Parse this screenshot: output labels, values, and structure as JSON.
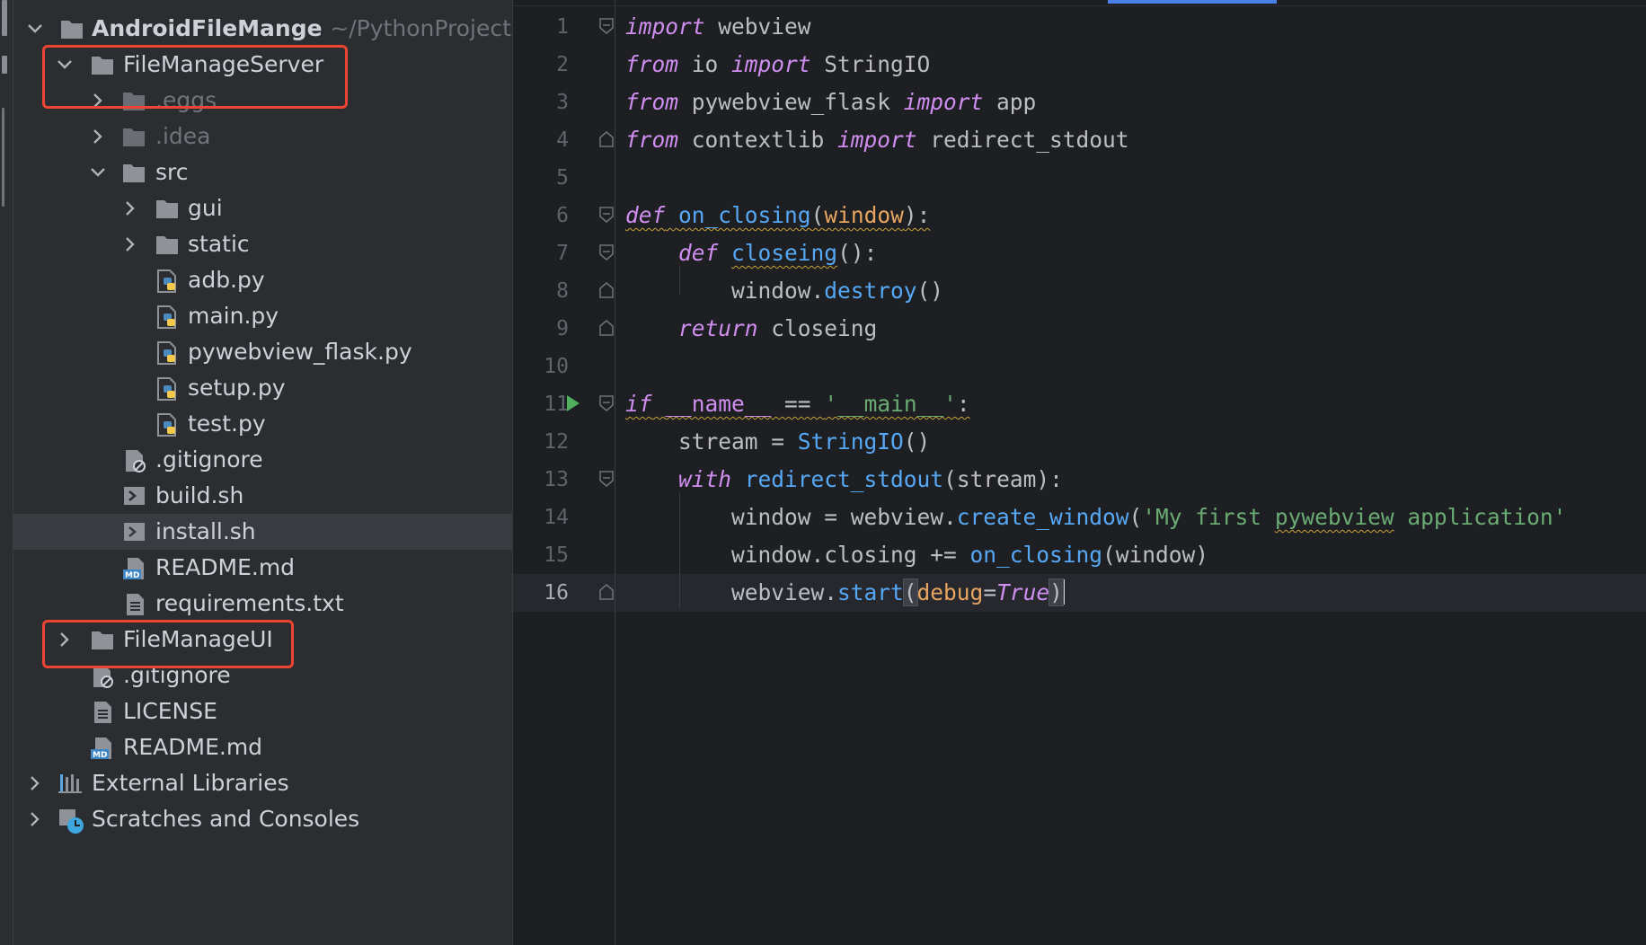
{
  "project": {
    "root_name": "AndroidFileMange",
    "root_path": "~/PythonProjects/",
    "items": [
      {
        "label": "FileManageServer"
      },
      {
        "label": ".eggs"
      },
      {
        "label": ".idea"
      },
      {
        "label": "src"
      },
      {
        "label": "gui"
      },
      {
        "label": "static"
      },
      {
        "label": "adb.py"
      },
      {
        "label": "main.py"
      },
      {
        "label": "pywebview_flask.py"
      },
      {
        "label": "setup.py"
      },
      {
        "label": "test.py"
      },
      {
        "label": ".gitignore"
      },
      {
        "label": "build.sh"
      },
      {
        "label": "install.sh"
      },
      {
        "label": "README.md"
      },
      {
        "label": "requirements.txt"
      },
      {
        "label": "FileManageUI"
      },
      {
        "label": ".gitignore"
      },
      {
        "label": "LICENSE"
      },
      {
        "label": "README.md"
      },
      {
        "label": "External Libraries"
      },
      {
        "label": "Scratches and Consoles"
      }
    ]
  },
  "editor": {
    "line_numbers": [
      "1",
      "2",
      "3",
      "4",
      "5",
      "6",
      "7",
      "8",
      "9",
      "10",
      "11",
      "12",
      "13",
      "14",
      "15",
      "16"
    ],
    "current_line": "16"
  },
  "colors": {
    "background": "#1e1f22",
    "panel": "#2b2d30",
    "keyword": "#cf8ef0",
    "function": "#56a8f5",
    "string": "#6aab73",
    "parameter": "#e8a561",
    "highlight_box": "#ee4433",
    "active_tab": "#4a7fe6"
  }
}
